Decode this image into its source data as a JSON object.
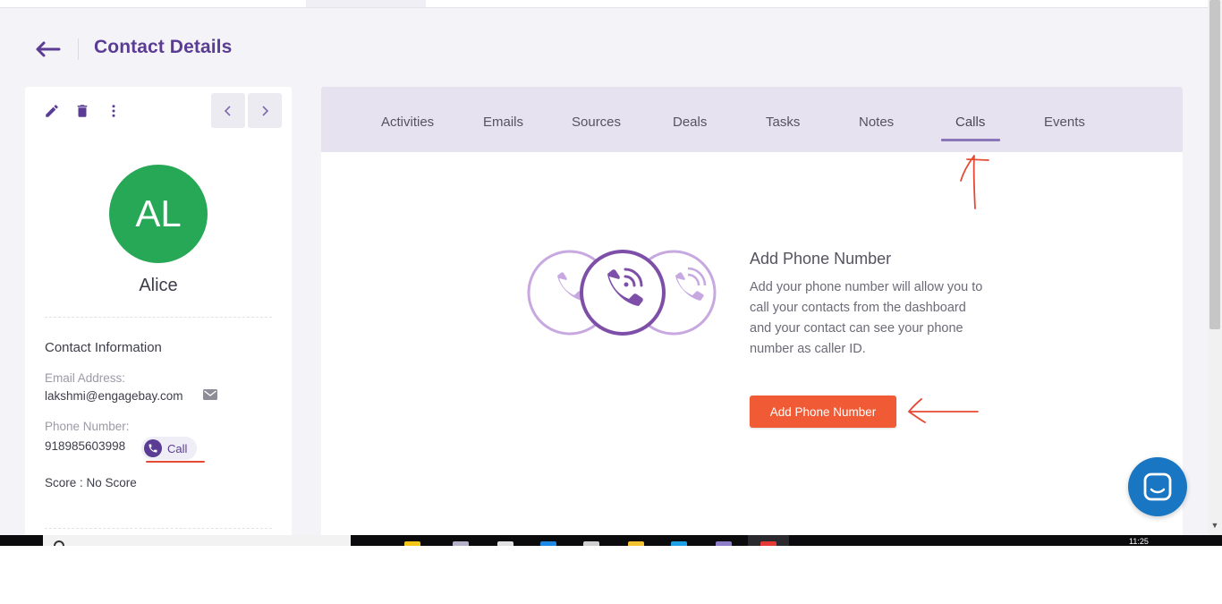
{
  "header": {
    "title": "Contact Details"
  },
  "contact": {
    "initials": "AL",
    "name": "Alice",
    "section_title": "Contact Information",
    "email_label": "Email Address:",
    "email": "lakshmi@engagebay.com",
    "phone_label": "Phone Number:",
    "phone": "918985603998",
    "call_label": "Call",
    "score": "Score : No Score"
  },
  "tabs": [
    {
      "label": "Activities"
    },
    {
      "label": "Emails"
    },
    {
      "label": "Sources"
    },
    {
      "label": "Deals"
    },
    {
      "label": "Tasks"
    },
    {
      "label": "Notes"
    },
    {
      "label": "Calls",
      "active": true
    },
    {
      "label": "Events"
    }
  ],
  "empty_state": {
    "title": "Add Phone Number",
    "description": "Add your phone number will allow you to call your contacts from the dashboard and your contact can see your phone number as caller ID.",
    "button_label": "Add Phone Number"
  },
  "taskbar": {
    "clock": "11:25"
  },
  "colors": {
    "brand_purple": "#5b3c95",
    "avatar_green": "#27a857",
    "cta_orange": "#f05a34",
    "chat_blue": "#1876c2",
    "annotation_red": "#e64a35"
  },
  "icons": [
    "back-arrow-icon",
    "edit-icon",
    "delete-icon",
    "more-vertical-icon",
    "chevron-left-icon",
    "chevron-right-icon",
    "mail-icon",
    "phone-icon",
    "calls-illustration",
    "chat-icon"
  ]
}
